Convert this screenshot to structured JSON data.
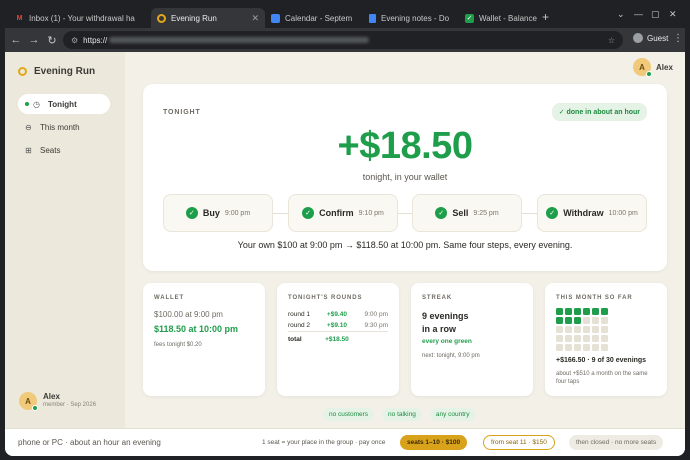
{
  "browser": {
    "tabs": [
      {
        "title": "Inbox (1) - Your withdrawal ha",
        "icon": "gmail-icon"
      },
      {
        "title": "Evening Run",
        "icon": "evening-run-icon"
      },
      {
        "title": "Calendar - Septem",
        "icon": "calendar-icon"
      },
      {
        "title": "Evening notes - Do",
        "icon": "docs-icon"
      },
      {
        "title": "Wallet - Balance",
        "icon": "wallet-icon"
      }
    ],
    "url_prefix": "https://",
    "profile": "Guest"
  },
  "app": {
    "name": "Evening Run",
    "nav": [
      {
        "label": "Tonight",
        "icon": "clock-icon",
        "active": true
      },
      {
        "label": "This month",
        "icon": "minus-circle-icon",
        "active": false
      },
      {
        "label": "Seats",
        "icon": "seats-icon",
        "active": false
      }
    ],
    "user": {
      "initial": "A",
      "name": "Alex",
      "member": "member · Sep 2026"
    }
  },
  "hero": {
    "label": "TONIGHT",
    "badge": "✓ done in about an hour",
    "amount": "+$18.50",
    "subtitle": "tonight, in your wallet",
    "steps": [
      {
        "name": "Buy",
        "time": "9:00 pm"
      },
      {
        "name": "Confirm",
        "time": "9:10 pm"
      },
      {
        "name": "Sell",
        "time": "9:25 pm"
      },
      {
        "name": "Withdraw",
        "time": "10:00 pm"
      }
    ],
    "summary": "Your own $100 at 9:00 pm → $118.50 at 10:00 pm. Same four steps, every evening."
  },
  "wallet": {
    "label": "WALLET",
    "start": "$100.00 at 9:00 pm",
    "end": "$118.50 at 10:00 pm",
    "fees": "fees tonight $0.20"
  },
  "rounds": {
    "label": "TONIGHT'S ROUNDS",
    "rows": [
      {
        "name": "round 1",
        "amount": "+$9.40",
        "time": "9:00 pm"
      },
      {
        "name": "round 2",
        "amount": "+$9.10",
        "time": "9:30 pm"
      }
    ],
    "total_label": "total",
    "total": "+$18.50"
  },
  "streak": {
    "label": "STREAK",
    "line1": "9 evenings",
    "line2": "in a row",
    "green": "every one green",
    "next": "next: tonight, 9:00 pm"
  },
  "month": {
    "label": "THIS MONTH SO FAR",
    "done": 9,
    "total": 30,
    "summary": "+$166.50 · 9 of 30 evenings",
    "projection": "about +$510 a month on the same four taps"
  },
  "pills": [
    "no customers",
    "no talking",
    "any country"
  ],
  "footer": {
    "left": "phone or PC · about an hour an evening",
    "note": "1 seat = your place in the group · pay once",
    "tier1": "seats 1–10 · $100",
    "tier2": "from seat 11 · $150",
    "tier3": "then closed · no more seats"
  },
  "colors": {
    "accent": "#1e9e4a",
    "gold": "#d9a21b",
    "bg": "#f3f0e7"
  }
}
